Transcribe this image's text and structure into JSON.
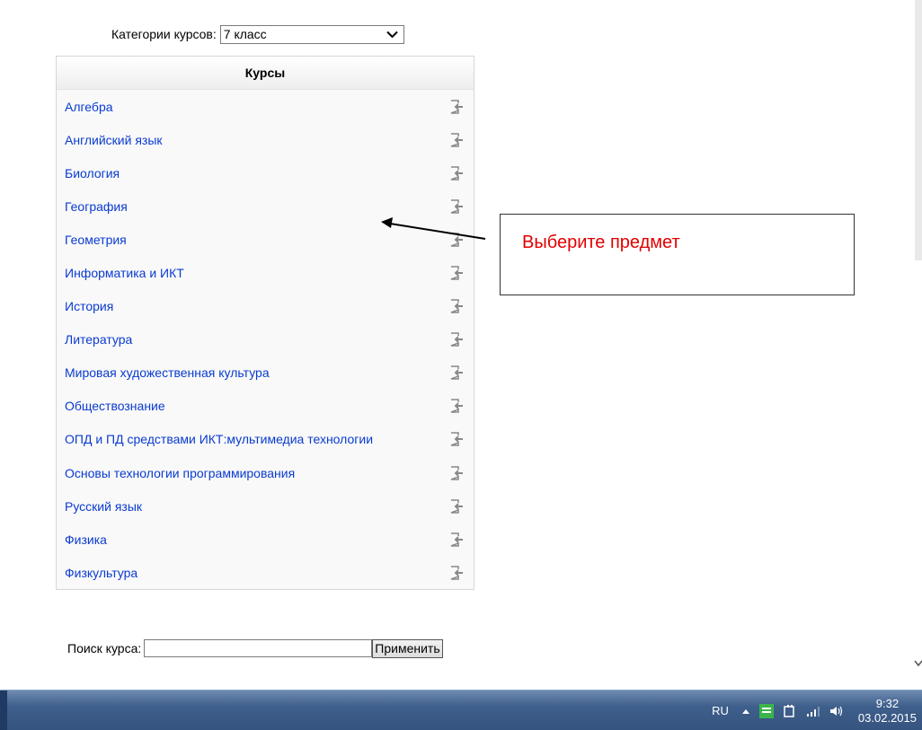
{
  "category": {
    "label": "Категории курсов:",
    "selected": "7 класс"
  },
  "courses": {
    "header": "Курсы",
    "items": [
      "Алгебра",
      "Английский язык",
      "Биология",
      "География",
      "Геометрия",
      "Информатика и ИКТ",
      "История",
      "Литература",
      "Мировая художественная культура",
      "Обществознание",
      "ОПД и ПД средствами ИКТ:мультимедиа технологии",
      "Основы технологии программирования",
      "Русский язык",
      "Физика",
      "Физкультура"
    ],
    "enter_icon": "enter-course-icon"
  },
  "annotation": {
    "text": "Выберите предмет",
    "color": "#e30000"
  },
  "search": {
    "label": "Поиск курса:",
    "value": "",
    "button": "Применить"
  },
  "taskbar": {
    "lang": "RU",
    "time": "9:32",
    "date": "03.02.2015"
  },
  "colors": {
    "link": "#0a3bd1",
    "taskbar": "#3f5f8c"
  }
}
